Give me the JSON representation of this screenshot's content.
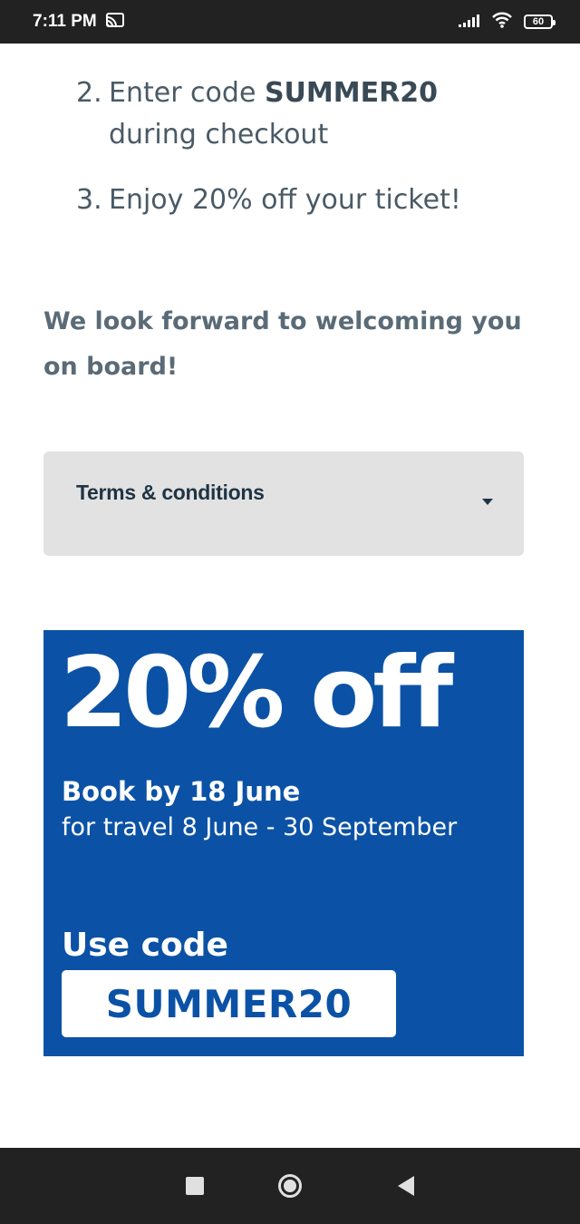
{
  "status_bar": {
    "time": "7:11 PM",
    "battery": "60",
    "icons": [
      "cast-icon",
      "signal-icon",
      "wifi-icon",
      "battery-icon"
    ]
  },
  "steps": [
    {
      "number": "2.",
      "before": "Enter code ",
      "code": "SUMMER20",
      "after": " during checkout"
    },
    {
      "number": "3.",
      "text": "Enjoy 20% off your ticket!"
    }
  ],
  "closing_text": "We look forward to welcoming you on board!",
  "terms": {
    "label": "Terms & conditions",
    "icon": "caret-down-icon"
  },
  "promo": {
    "headline": "20% off",
    "book_by": "Book by 18 June",
    "travel": "for travel 8 June - 30 September",
    "use_code_label": "Use code",
    "code": "SUMMER20",
    "background": "#0b52a6"
  },
  "nav_bar": {
    "icons": [
      "recents-icon",
      "home-icon",
      "back-icon"
    ]
  }
}
